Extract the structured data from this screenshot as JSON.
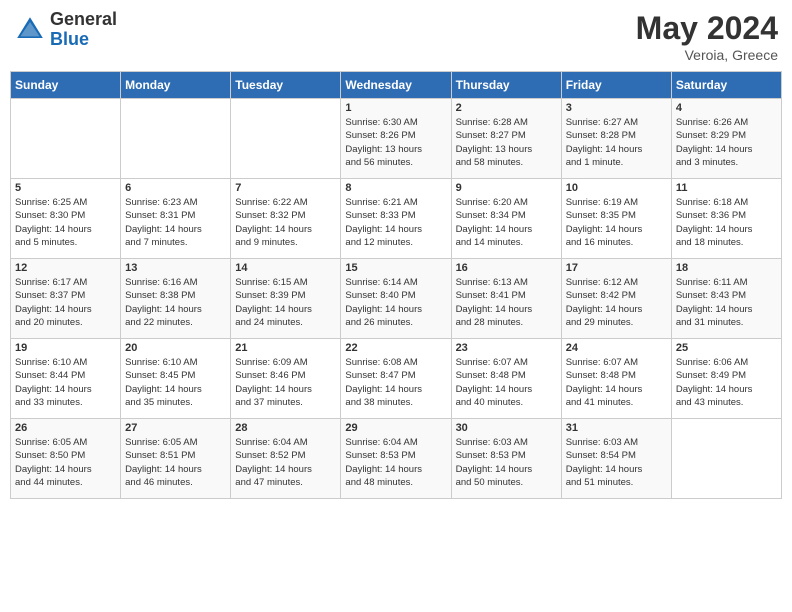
{
  "header": {
    "logo_general": "General",
    "logo_blue": "Blue",
    "month_year": "May 2024",
    "location": "Veroia, Greece"
  },
  "days_of_week": [
    "Sunday",
    "Monday",
    "Tuesday",
    "Wednesday",
    "Thursday",
    "Friday",
    "Saturday"
  ],
  "weeks": [
    [
      {
        "day": "",
        "info": ""
      },
      {
        "day": "",
        "info": ""
      },
      {
        "day": "",
        "info": ""
      },
      {
        "day": "1",
        "info": "Sunrise: 6:30 AM\nSunset: 8:26 PM\nDaylight: 13 hours\nand 56 minutes."
      },
      {
        "day": "2",
        "info": "Sunrise: 6:28 AM\nSunset: 8:27 PM\nDaylight: 13 hours\nand 58 minutes."
      },
      {
        "day": "3",
        "info": "Sunrise: 6:27 AM\nSunset: 8:28 PM\nDaylight: 14 hours\nand 1 minute."
      },
      {
        "day": "4",
        "info": "Sunrise: 6:26 AM\nSunset: 8:29 PM\nDaylight: 14 hours\nand 3 minutes."
      }
    ],
    [
      {
        "day": "5",
        "info": "Sunrise: 6:25 AM\nSunset: 8:30 PM\nDaylight: 14 hours\nand 5 minutes."
      },
      {
        "day": "6",
        "info": "Sunrise: 6:23 AM\nSunset: 8:31 PM\nDaylight: 14 hours\nand 7 minutes."
      },
      {
        "day": "7",
        "info": "Sunrise: 6:22 AM\nSunset: 8:32 PM\nDaylight: 14 hours\nand 9 minutes."
      },
      {
        "day": "8",
        "info": "Sunrise: 6:21 AM\nSunset: 8:33 PM\nDaylight: 14 hours\nand 12 minutes."
      },
      {
        "day": "9",
        "info": "Sunrise: 6:20 AM\nSunset: 8:34 PM\nDaylight: 14 hours\nand 14 minutes."
      },
      {
        "day": "10",
        "info": "Sunrise: 6:19 AM\nSunset: 8:35 PM\nDaylight: 14 hours\nand 16 minutes."
      },
      {
        "day": "11",
        "info": "Sunrise: 6:18 AM\nSunset: 8:36 PM\nDaylight: 14 hours\nand 18 minutes."
      }
    ],
    [
      {
        "day": "12",
        "info": "Sunrise: 6:17 AM\nSunset: 8:37 PM\nDaylight: 14 hours\nand 20 minutes."
      },
      {
        "day": "13",
        "info": "Sunrise: 6:16 AM\nSunset: 8:38 PM\nDaylight: 14 hours\nand 22 minutes."
      },
      {
        "day": "14",
        "info": "Sunrise: 6:15 AM\nSunset: 8:39 PM\nDaylight: 14 hours\nand 24 minutes."
      },
      {
        "day": "15",
        "info": "Sunrise: 6:14 AM\nSunset: 8:40 PM\nDaylight: 14 hours\nand 26 minutes."
      },
      {
        "day": "16",
        "info": "Sunrise: 6:13 AM\nSunset: 8:41 PM\nDaylight: 14 hours\nand 28 minutes."
      },
      {
        "day": "17",
        "info": "Sunrise: 6:12 AM\nSunset: 8:42 PM\nDaylight: 14 hours\nand 29 minutes."
      },
      {
        "day": "18",
        "info": "Sunrise: 6:11 AM\nSunset: 8:43 PM\nDaylight: 14 hours\nand 31 minutes."
      }
    ],
    [
      {
        "day": "19",
        "info": "Sunrise: 6:10 AM\nSunset: 8:44 PM\nDaylight: 14 hours\nand 33 minutes."
      },
      {
        "day": "20",
        "info": "Sunrise: 6:10 AM\nSunset: 8:45 PM\nDaylight: 14 hours\nand 35 minutes."
      },
      {
        "day": "21",
        "info": "Sunrise: 6:09 AM\nSunset: 8:46 PM\nDaylight: 14 hours\nand 37 minutes."
      },
      {
        "day": "22",
        "info": "Sunrise: 6:08 AM\nSunset: 8:47 PM\nDaylight: 14 hours\nand 38 minutes."
      },
      {
        "day": "23",
        "info": "Sunrise: 6:07 AM\nSunset: 8:48 PM\nDaylight: 14 hours\nand 40 minutes."
      },
      {
        "day": "24",
        "info": "Sunrise: 6:07 AM\nSunset: 8:48 PM\nDaylight: 14 hours\nand 41 minutes."
      },
      {
        "day": "25",
        "info": "Sunrise: 6:06 AM\nSunset: 8:49 PM\nDaylight: 14 hours\nand 43 minutes."
      }
    ],
    [
      {
        "day": "26",
        "info": "Sunrise: 6:05 AM\nSunset: 8:50 PM\nDaylight: 14 hours\nand 44 minutes."
      },
      {
        "day": "27",
        "info": "Sunrise: 6:05 AM\nSunset: 8:51 PM\nDaylight: 14 hours\nand 46 minutes."
      },
      {
        "day": "28",
        "info": "Sunrise: 6:04 AM\nSunset: 8:52 PM\nDaylight: 14 hours\nand 47 minutes."
      },
      {
        "day": "29",
        "info": "Sunrise: 6:04 AM\nSunset: 8:53 PM\nDaylight: 14 hours\nand 48 minutes."
      },
      {
        "day": "30",
        "info": "Sunrise: 6:03 AM\nSunset: 8:53 PM\nDaylight: 14 hours\nand 50 minutes."
      },
      {
        "day": "31",
        "info": "Sunrise: 6:03 AM\nSunset: 8:54 PM\nDaylight: 14 hours\nand 51 minutes."
      },
      {
        "day": "",
        "info": ""
      }
    ]
  ]
}
